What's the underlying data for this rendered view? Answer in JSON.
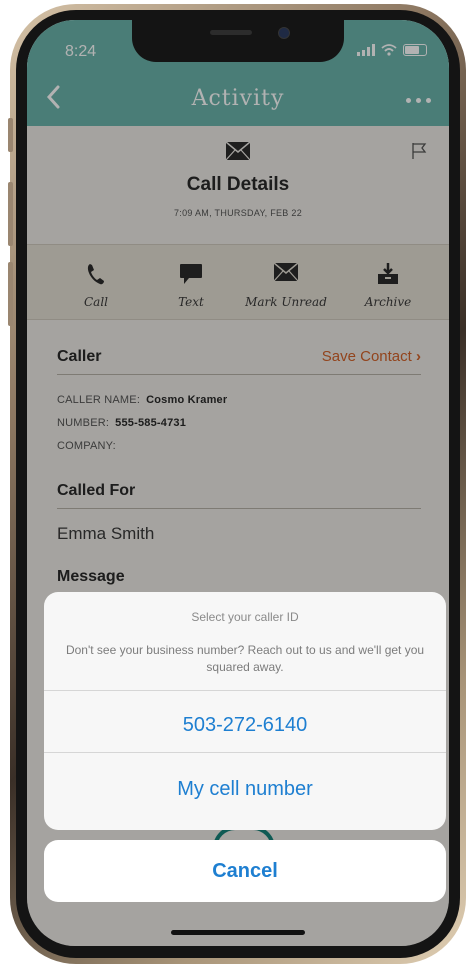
{
  "status_bar": {
    "time": "8:24"
  },
  "nav": {
    "title": "Activity",
    "back_icon": "chevron-left-icon",
    "more_icon": "ellipsis-icon"
  },
  "details": {
    "title": "Call Details",
    "date": "7:09 AM, THURSDAY, FEB 22",
    "icon": "envelope-icon",
    "flag_icon": "flag-icon"
  },
  "actions": [
    {
      "label": "Call",
      "icon": "phone-icon"
    },
    {
      "label": "Text",
      "icon": "chat-bubble-icon"
    },
    {
      "label": "Mark Unread",
      "icon": "envelope-icon"
    },
    {
      "label": "Archive",
      "icon": "archive-icon"
    }
  ],
  "caller": {
    "heading": "Caller",
    "save_contact": "Save Contact",
    "name_label": "CALLER NAME:",
    "name_value": "Cosmo Kramer",
    "number_label": "NUMBER:",
    "number_value": "555-585-4731",
    "company_label": "COMPANY:"
  },
  "called_for": {
    "heading": "Called For",
    "value": "Emma Smith"
  },
  "message": {
    "heading": "Message"
  },
  "action_sheet": {
    "title": "Select your caller ID",
    "message": "Don't see your business number? Reach out to us and we'll get you squared away.",
    "options": [
      "503-272-6140",
      "My cell number"
    ],
    "cancel": "Cancel"
  },
  "colors": {
    "teal": "#6ab4ab",
    "accent_orange": "#d2622a",
    "ios_blue": "#1e7fd1"
  }
}
